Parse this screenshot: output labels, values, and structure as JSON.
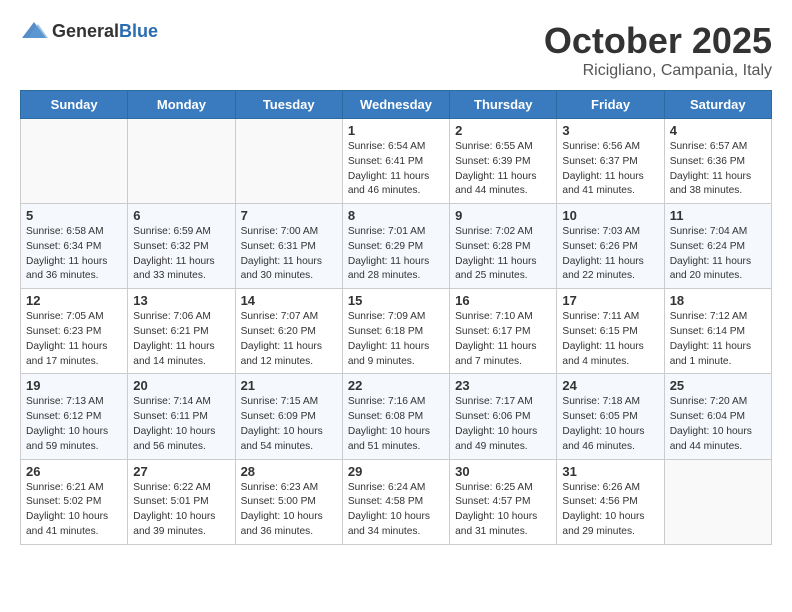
{
  "header": {
    "logo_general": "General",
    "logo_blue": "Blue",
    "month": "October 2025",
    "location": "Ricigliano, Campania, Italy"
  },
  "weekdays": [
    "Sunday",
    "Monday",
    "Tuesday",
    "Wednesday",
    "Thursday",
    "Friday",
    "Saturday"
  ],
  "weeks": [
    [
      {
        "day": "",
        "info": ""
      },
      {
        "day": "",
        "info": ""
      },
      {
        "day": "",
        "info": ""
      },
      {
        "day": "1",
        "info": "Sunrise: 6:54 AM\nSunset: 6:41 PM\nDaylight: 11 hours\nand 46 minutes."
      },
      {
        "day": "2",
        "info": "Sunrise: 6:55 AM\nSunset: 6:39 PM\nDaylight: 11 hours\nand 44 minutes."
      },
      {
        "day": "3",
        "info": "Sunrise: 6:56 AM\nSunset: 6:37 PM\nDaylight: 11 hours\nand 41 minutes."
      },
      {
        "day": "4",
        "info": "Sunrise: 6:57 AM\nSunset: 6:36 PM\nDaylight: 11 hours\nand 38 minutes."
      }
    ],
    [
      {
        "day": "5",
        "info": "Sunrise: 6:58 AM\nSunset: 6:34 PM\nDaylight: 11 hours\nand 36 minutes."
      },
      {
        "day": "6",
        "info": "Sunrise: 6:59 AM\nSunset: 6:32 PM\nDaylight: 11 hours\nand 33 minutes."
      },
      {
        "day": "7",
        "info": "Sunrise: 7:00 AM\nSunset: 6:31 PM\nDaylight: 11 hours\nand 30 minutes."
      },
      {
        "day": "8",
        "info": "Sunrise: 7:01 AM\nSunset: 6:29 PM\nDaylight: 11 hours\nand 28 minutes."
      },
      {
        "day": "9",
        "info": "Sunrise: 7:02 AM\nSunset: 6:28 PM\nDaylight: 11 hours\nand 25 minutes."
      },
      {
        "day": "10",
        "info": "Sunrise: 7:03 AM\nSunset: 6:26 PM\nDaylight: 11 hours\nand 22 minutes."
      },
      {
        "day": "11",
        "info": "Sunrise: 7:04 AM\nSunset: 6:24 PM\nDaylight: 11 hours\nand 20 minutes."
      }
    ],
    [
      {
        "day": "12",
        "info": "Sunrise: 7:05 AM\nSunset: 6:23 PM\nDaylight: 11 hours\nand 17 minutes."
      },
      {
        "day": "13",
        "info": "Sunrise: 7:06 AM\nSunset: 6:21 PM\nDaylight: 11 hours\nand 14 minutes."
      },
      {
        "day": "14",
        "info": "Sunrise: 7:07 AM\nSunset: 6:20 PM\nDaylight: 11 hours\nand 12 minutes."
      },
      {
        "day": "15",
        "info": "Sunrise: 7:09 AM\nSunset: 6:18 PM\nDaylight: 11 hours\nand 9 minutes."
      },
      {
        "day": "16",
        "info": "Sunrise: 7:10 AM\nSunset: 6:17 PM\nDaylight: 11 hours\nand 7 minutes."
      },
      {
        "day": "17",
        "info": "Sunrise: 7:11 AM\nSunset: 6:15 PM\nDaylight: 11 hours\nand 4 minutes."
      },
      {
        "day": "18",
        "info": "Sunrise: 7:12 AM\nSunset: 6:14 PM\nDaylight: 11 hours\nand 1 minute."
      }
    ],
    [
      {
        "day": "19",
        "info": "Sunrise: 7:13 AM\nSunset: 6:12 PM\nDaylight: 10 hours\nand 59 minutes."
      },
      {
        "day": "20",
        "info": "Sunrise: 7:14 AM\nSunset: 6:11 PM\nDaylight: 10 hours\nand 56 minutes."
      },
      {
        "day": "21",
        "info": "Sunrise: 7:15 AM\nSunset: 6:09 PM\nDaylight: 10 hours\nand 54 minutes."
      },
      {
        "day": "22",
        "info": "Sunrise: 7:16 AM\nSunset: 6:08 PM\nDaylight: 10 hours\nand 51 minutes."
      },
      {
        "day": "23",
        "info": "Sunrise: 7:17 AM\nSunset: 6:06 PM\nDaylight: 10 hours\nand 49 minutes."
      },
      {
        "day": "24",
        "info": "Sunrise: 7:18 AM\nSunset: 6:05 PM\nDaylight: 10 hours\nand 46 minutes."
      },
      {
        "day": "25",
        "info": "Sunrise: 7:20 AM\nSunset: 6:04 PM\nDaylight: 10 hours\nand 44 minutes."
      }
    ],
    [
      {
        "day": "26",
        "info": "Sunrise: 6:21 AM\nSunset: 5:02 PM\nDaylight: 10 hours\nand 41 minutes."
      },
      {
        "day": "27",
        "info": "Sunrise: 6:22 AM\nSunset: 5:01 PM\nDaylight: 10 hours\nand 39 minutes."
      },
      {
        "day": "28",
        "info": "Sunrise: 6:23 AM\nSunset: 5:00 PM\nDaylight: 10 hours\nand 36 minutes."
      },
      {
        "day": "29",
        "info": "Sunrise: 6:24 AM\nSunset: 4:58 PM\nDaylight: 10 hours\nand 34 minutes."
      },
      {
        "day": "30",
        "info": "Sunrise: 6:25 AM\nSunset: 4:57 PM\nDaylight: 10 hours\nand 31 minutes."
      },
      {
        "day": "31",
        "info": "Sunrise: 6:26 AM\nSunset: 4:56 PM\nDaylight: 10 hours\nand 29 minutes."
      },
      {
        "day": "",
        "info": ""
      }
    ]
  ]
}
